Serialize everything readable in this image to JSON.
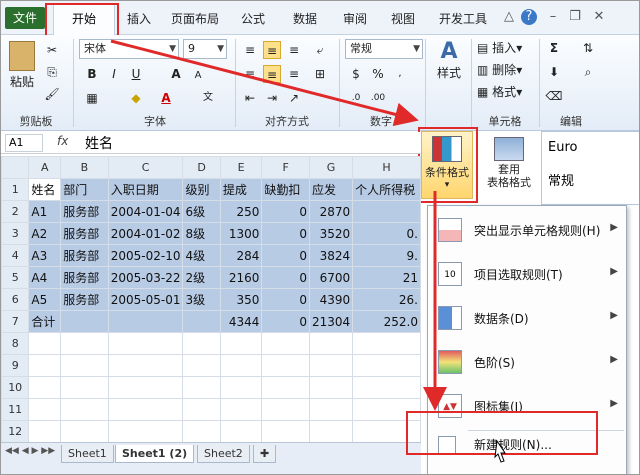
{
  "menubar": {
    "tabs": [
      "文件",
      "开始",
      "插入",
      "页面布局",
      "公式",
      "数据",
      "审阅",
      "视图",
      "开发工具"
    ]
  },
  "ribbon": {
    "font_name": "宋体",
    "font_size": "9",
    "number_format": "常规",
    "groups": {
      "clipboard": "剪贴板",
      "font": "字体",
      "alignment": "对齐方式",
      "number": "数字",
      "cells": "单元格",
      "editing": "编辑"
    },
    "paste": "粘贴",
    "style_btn": "样式",
    "insert": "插入",
    "delete": "删除",
    "format": "格式",
    "cf_label": "条件格式",
    "table_format": "套用\n表格格式",
    "style_euro": "Euro",
    "style_normal": "常规"
  },
  "formula_bar": {
    "name_box": "A1",
    "fx": "fx",
    "value": "姓名"
  },
  "grid": {
    "columns": [
      "A",
      "B",
      "C",
      "D",
      "E",
      "F",
      "G",
      "H"
    ],
    "rows": [
      [
        "姓名",
        "部门",
        "入职日期",
        "级别",
        "提成",
        "缺勤扣",
        "应发",
        "个人所得税"
      ],
      [
        "A1",
        "服务部",
        "2004-01-04",
        "6级",
        "250",
        "0",
        "2870",
        ""
      ],
      [
        "A2",
        "服务部",
        "2004-01-02",
        "8级",
        "1300",
        "0",
        "3520",
        "0."
      ],
      [
        "A3",
        "服务部",
        "2005-02-10",
        "4级",
        "284",
        "0",
        "3824",
        "9."
      ],
      [
        "A4",
        "服务部",
        "2005-03-22",
        "2级",
        "2160",
        "0",
        "6700",
        "21"
      ],
      [
        "A5",
        "服务部",
        "2005-05-01",
        "3级",
        "350",
        "0",
        "4390",
        "26."
      ],
      [
        "合计",
        "",
        "",
        "",
        "4344",
        "0",
        "21304",
        "252.0"
      ],
      [
        "",
        "",
        "",
        "",
        "",
        "",
        "",
        ""
      ],
      [
        "",
        "",
        "",
        "",
        "",
        "",
        "",
        ""
      ],
      [
        "",
        "",
        "",
        "",
        "",
        "",
        "",
        ""
      ],
      [
        "",
        "",
        "",
        "",
        "",
        "",
        "",
        ""
      ],
      [
        "",
        "",
        "",
        "",
        "",
        "",
        "",
        ""
      ]
    ],
    "row_numbers": [
      "1",
      "2",
      "3",
      "4",
      "5",
      "6",
      "7",
      "8",
      "9",
      "10",
      "11",
      "12"
    ]
  },
  "sheet_tabs": [
    "Sheet1",
    "Sheet1 (2)",
    "Sheet2"
  ],
  "cf_menu": {
    "items": [
      {
        "label": "突出显示单元格规则(H)",
        "icon": "highlight-rules-icon"
      },
      {
        "label": "项目选取规则(T)",
        "icon": "top-bottom-icon"
      },
      {
        "label": "数据条(D)",
        "icon": "data-bars-icon"
      },
      {
        "label": "色阶(S)",
        "icon": "color-scale-icon"
      },
      {
        "label": "图标集(I)",
        "icon": "icon-sets-icon"
      }
    ],
    "new_rule": "新建规则(N)..."
  },
  "colors": {
    "accent_red": "#e02a2a",
    "file_tab": "#2a6f2e",
    "selection": "#b8cbe5"
  }
}
